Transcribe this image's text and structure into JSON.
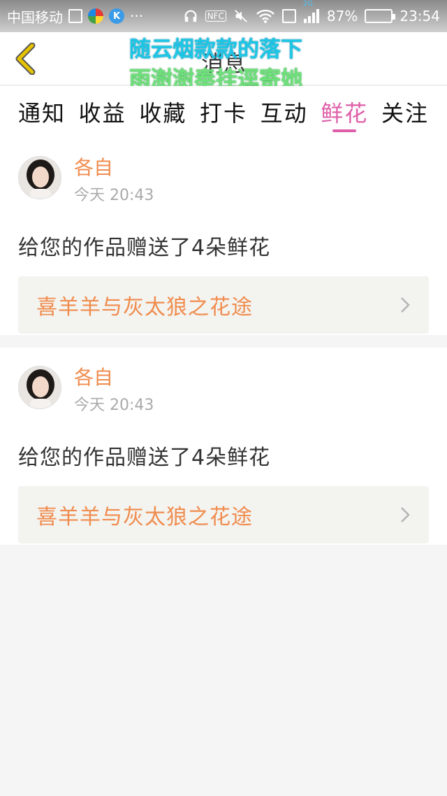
{
  "status_bar": {
    "carrier": "中国移动",
    "nfc": "NFC",
    "network": "2G",
    "battery_percent": "87%",
    "battery_level": 0.87,
    "time": "23:54",
    "k_badge": "K"
  },
  "header": {
    "title": "消息",
    "overlay_line1": "随云烟款款的落下",
    "overlay_line2": "雨澍澍奉挂逕寄她"
  },
  "tabs": [
    {
      "label": "通知",
      "active": false
    },
    {
      "label": "收益",
      "active": false
    },
    {
      "label": "收藏",
      "active": false
    },
    {
      "label": "打卡",
      "active": false
    },
    {
      "label": "互动",
      "active": false
    },
    {
      "label": "鲜花",
      "active": true
    },
    {
      "label": "关注",
      "active": false
    }
  ],
  "messages": [
    {
      "username": "各自",
      "time": "今天 20:43",
      "text": "给您的作品赠送了4朵鲜花",
      "work_title": "喜羊羊与灰太狼之花途"
    },
    {
      "username": "各自",
      "time": "今天 20:43",
      "text": "给您的作品赠送了4朵鲜花",
      "work_title": "喜羊羊与灰太狼之花途"
    }
  ],
  "colors": {
    "accent_pink": "#de5ea8",
    "accent_orange": "#f08c4e",
    "back_arrow": "#e6c200"
  }
}
